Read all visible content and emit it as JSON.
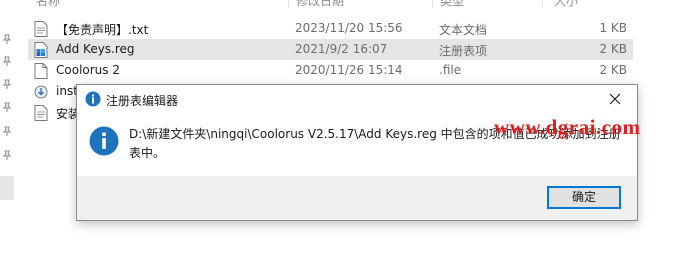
{
  "explorer": {
    "header": {
      "name_col": "名称",
      "date_col": "修改日期",
      "type_col": "类型",
      "size_col": "大小"
    },
    "files": [
      {
        "name": "【免责声明】.txt",
        "date": "2023/11/20 15:56",
        "type": "文本文档",
        "size": "1 KB",
        "icon": "text-file-icon"
      },
      {
        "name": "Add Keys.reg",
        "date": "2021/9/2 16:07",
        "type": "注册表项",
        "size": "2 KB",
        "icon": "registry-file-icon"
      },
      {
        "name": "Coolorus 2",
        "date": "2020/11/26 15:14",
        "type": ".file",
        "size": "2 KB",
        "icon": "blank-file-icon"
      },
      {
        "name": "inst",
        "date": "",
        "type": "",
        "size": "",
        "icon": "installer-icon"
      },
      {
        "name": "安装",
        "date": "",
        "type": "",
        "size": "",
        "icon": "text-file-icon"
      }
    ]
  },
  "dialog": {
    "title": "注册表编辑器",
    "message": "D:\\新建文件夹\\ningqi\\Coolorus V2.5.17\\Add Keys.reg 中包含的项和值已成功添加到注册表中。",
    "ok_label": "确定",
    "accent": "#0078d7"
  },
  "watermark": "www.dgrai.com",
  "colors": {
    "selected_row": "#e5e5e5",
    "watermark": "#e11d1d",
    "info_icon": "#1e73be"
  }
}
